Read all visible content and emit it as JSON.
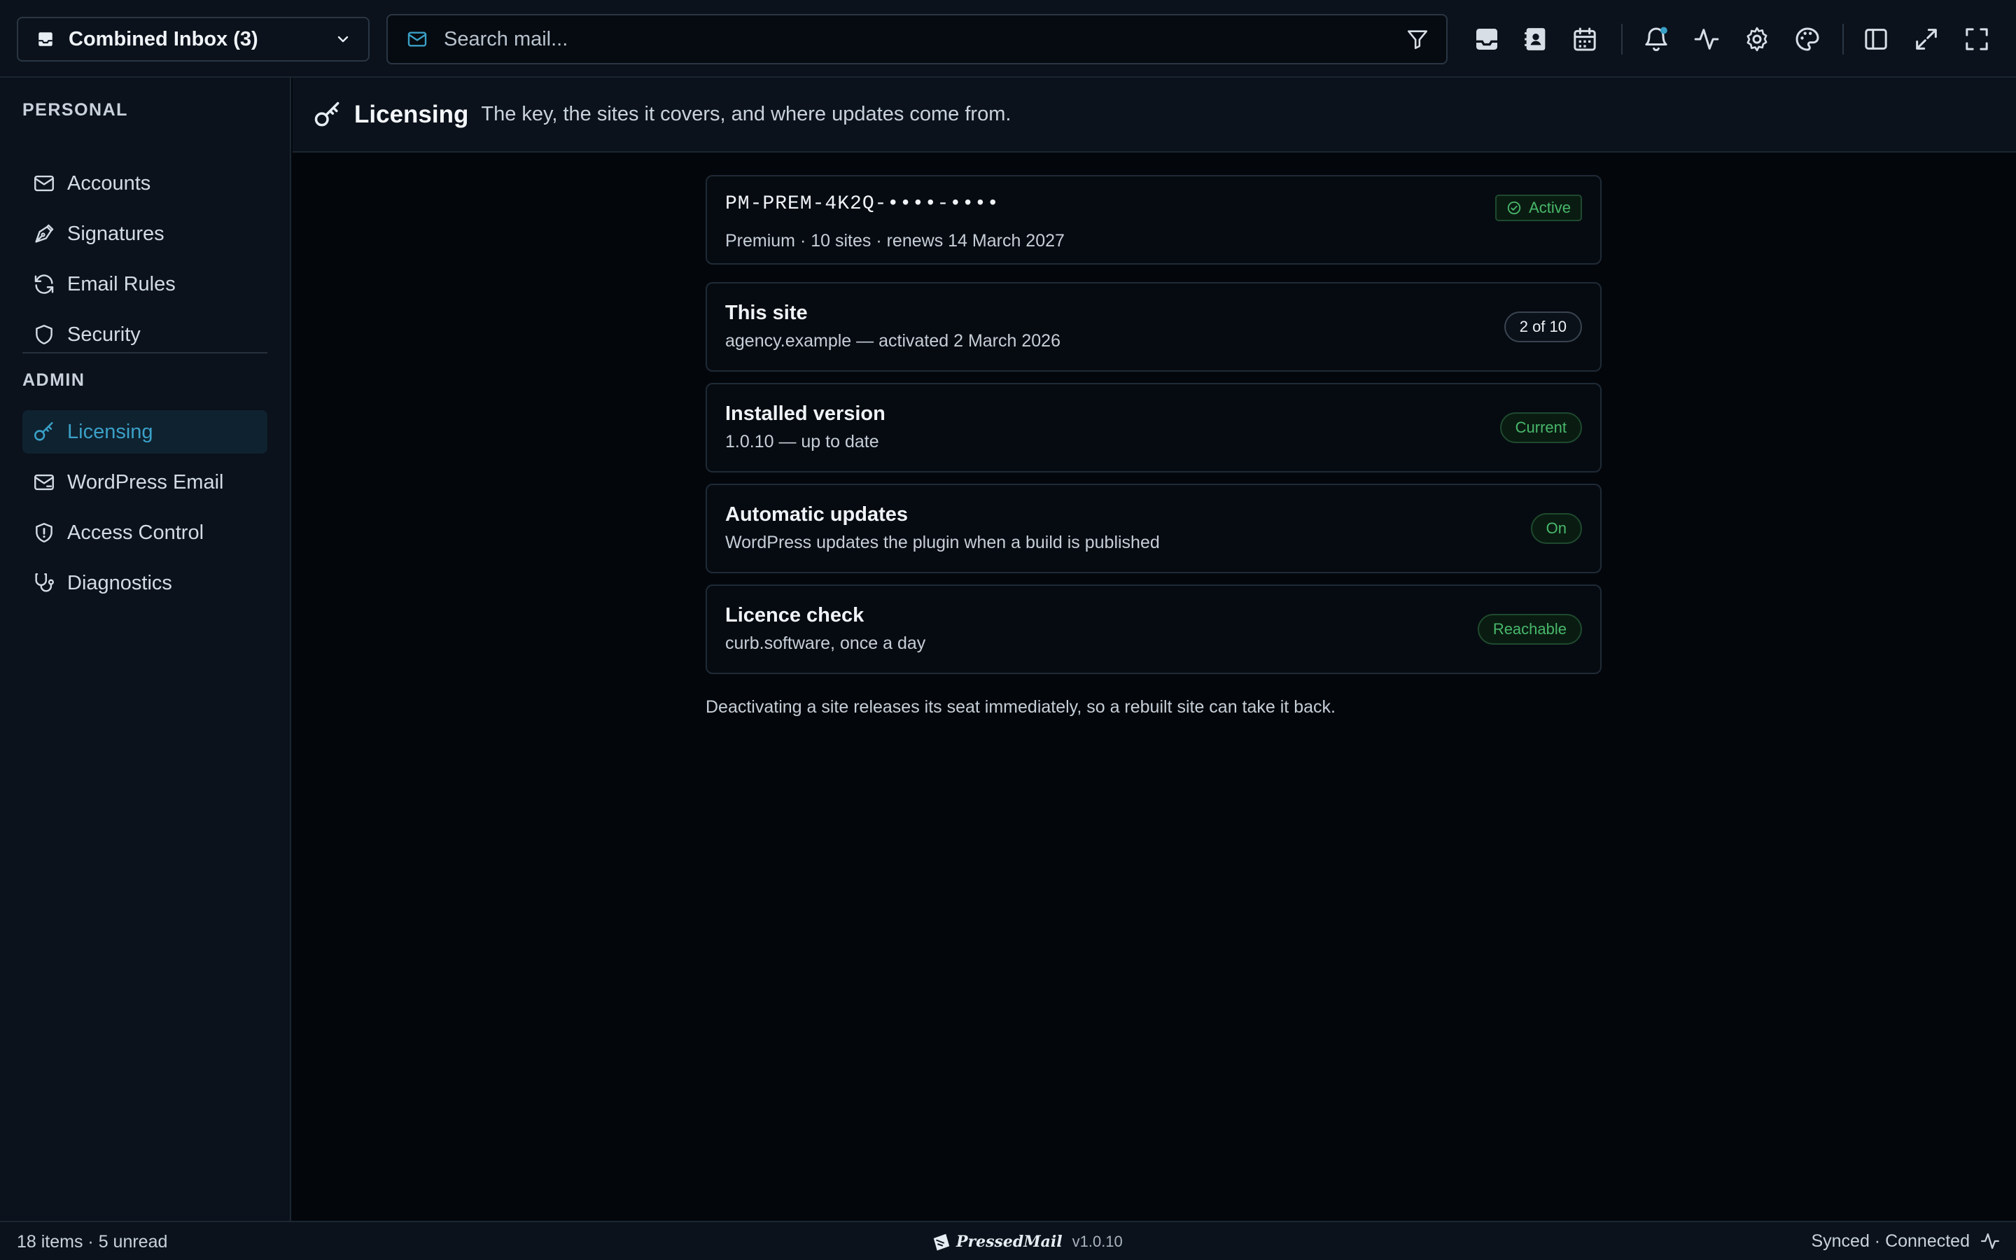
{
  "topbar": {
    "inbox_label": "Combined Inbox (3)",
    "search_placeholder": "Search mail..."
  },
  "sidebar": {
    "personal_heading": "PERSONAL",
    "personal_items": [
      {
        "label": "Accounts",
        "icon": "mail-icon"
      },
      {
        "label": "Signatures",
        "icon": "pen-icon"
      },
      {
        "label": "Email Rules",
        "icon": "refresh-icon"
      },
      {
        "label": "Security",
        "icon": "shield-icon"
      }
    ],
    "admin_heading": "ADMIN",
    "admin_items": [
      {
        "label": "Licensing",
        "icon": "key-icon",
        "active": true
      },
      {
        "label": "WordPress Email",
        "icon": "mail-open-icon"
      },
      {
        "label": "Access Control",
        "icon": "shield-alert-icon"
      },
      {
        "label": "Diagnostics",
        "icon": "stethoscope-icon"
      }
    ]
  },
  "page": {
    "title": "Licensing",
    "subtitle": "The key, the sites it covers, and where updates come from."
  },
  "cards": [
    {
      "title": "PM-PREM-4K2Q-••••-••••",
      "detail": "Premium · 10 sites · renews 14 March 2027",
      "badge": "Active"
    },
    {
      "title": "This site",
      "detail": "agency.example — activated 2 March 2026",
      "badge": "2 of 10"
    },
    {
      "title": "Installed version",
      "detail": "1.0.10 — up to date",
      "badge": "Current"
    },
    {
      "title": "Automatic updates",
      "detail": "WordPress updates the plugin when a build is published",
      "badge": "On"
    },
    {
      "title": "Licence check",
      "detail": "curb.software, once a day",
      "badge": "Reachable"
    }
  ],
  "note": "Deactivating a site releases its seat immediately, so a rebuilt site can take it back.",
  "statusbar": {
    "items_text": "18 items · 5 unread",
    "brand": "PressedMail",
    "version": "v1.0.10",
    "sync_text": "Synced · Connected"
  },
  "colors": {
    "accent": "#3aa0c7",
    "success": "#48b86a",
    "background": "#03070c",
    "panel": "#0b121b"
  }
}
